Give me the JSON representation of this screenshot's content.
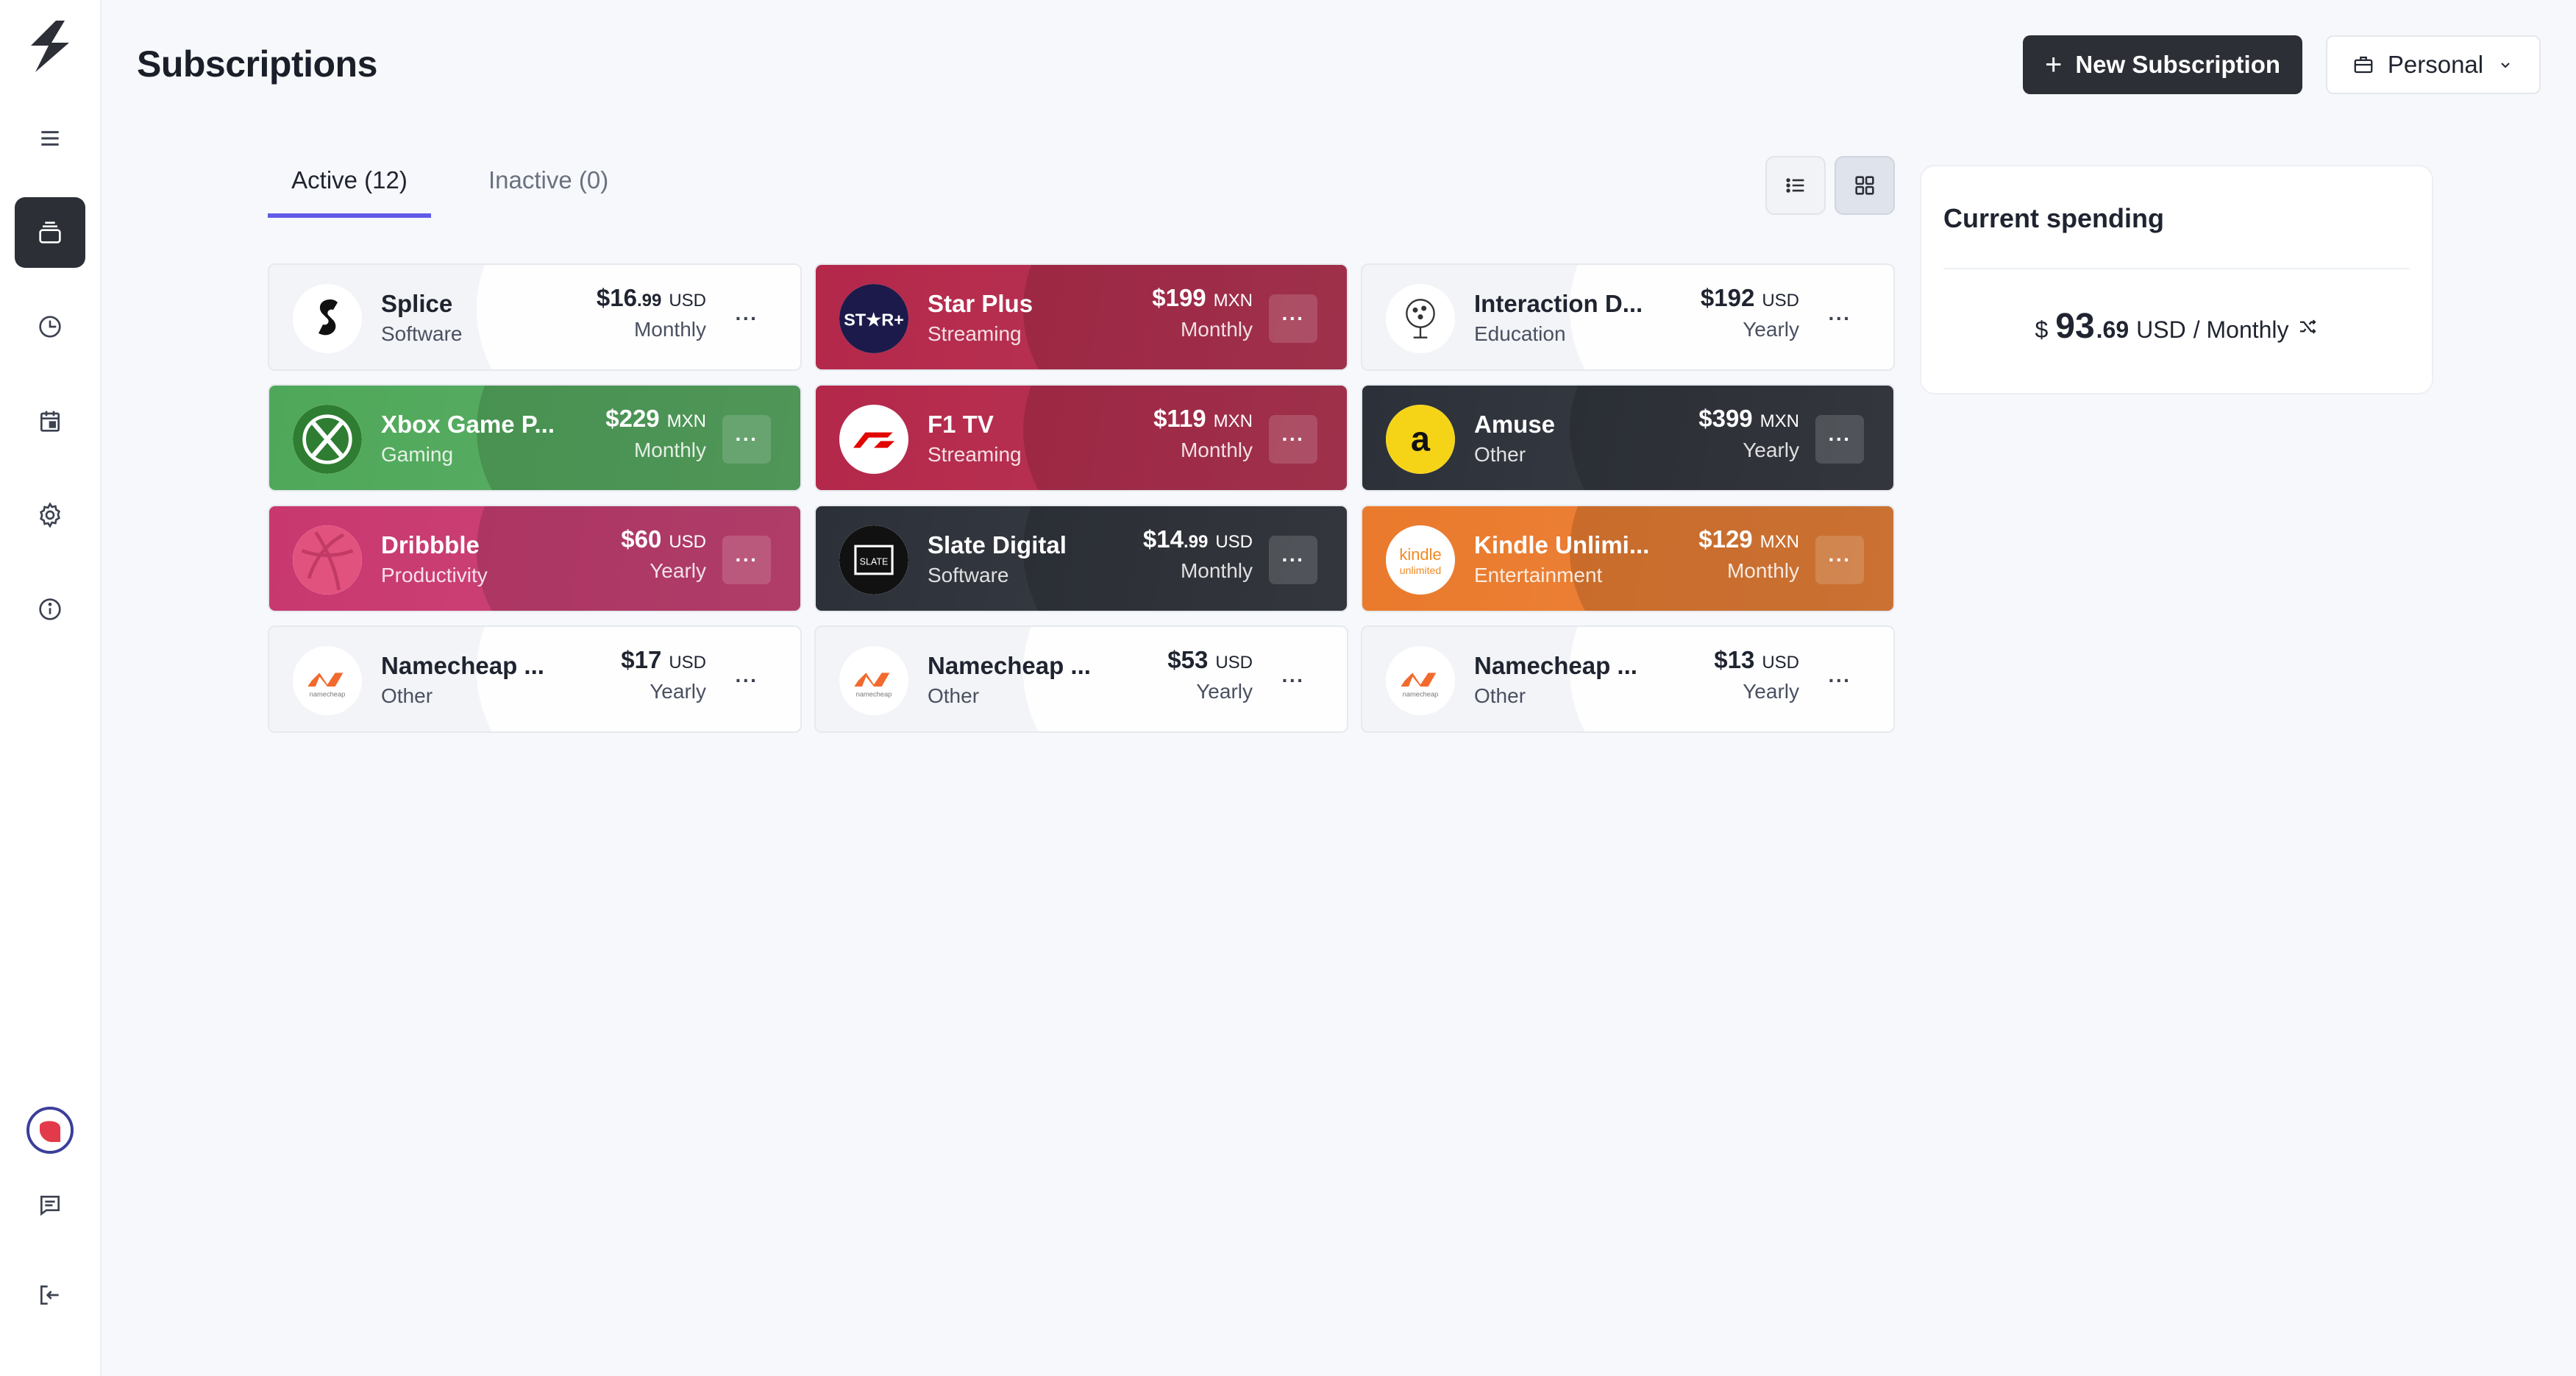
{
  "page": {
    "title": "Subscriptions",
    "new_button_label": "New Subscription",
    "workspace_label": "Personal"
  },
  "tabs": [
    {
      "label": "Active (12)",
      "active": true
    },
    {
      "label": "Inactive (0)",
      "active": false
    }
  ],
  "view_toggle": {
    "selected": "grid",
    "options": [
      "list-icon",
      "grid-icon"
    ]
  },
  "sidebar": {
    "items": [
      {
        "icon": "menu-icon"
      },
      {
        "icon": "subscriptions-icon",
        "active": true
      },
      {
        "icon": "clock-icon"
      },
      {
        "icon": "calendar-icon"
      },
      {
        "icon": "gear-icon"
      },
      {
        "icon": "info-icon"
      }
    ],
    "bottom": [
      {
        "icon": "avatar"
      },
      {
        "icon": "feedback-icon"
      },
      {
        "icon": "logout-icon"
      }
    ]
  },
  "cards": [
    {
      "name": "Splice",
      "category": "Software",
      "price": "$16",
      "cents": ".99",
      "currency": "USD",
      "period": "Monthly",
      "theme": "light",
      "color": "#f3f4f7"
    },
    {
      "name": "Star Plus",
      "category": "Streaming",
      "price": "$199",
      "cents": "",
      "currency": "MXN",
      "period": "Monthly",
      "theme": "dark",
      "color": "#b4284a"
    },
    {
      "name": "Interaction D...",
      "category": "Education",
      "price": "$192",
      "cents": "",
      "currency": "USD",
      "period": "Yearly",
      "theme": "light",
      "color": "#f3f4f7"
    },
    {
      "name": "Xbox Game P...",
      "category": "Gaming",
      "price": "$229",
      "cents": "",
      "currency": "MXN",
      "period": "Monthly",
      "theme": "dark",
      "color": "#4fa85a"
    },
    {
      "name": "F1 TV",
      "category": "Streaming",
      "price": "$119",
      "cents": "",
      "currency": "MXN",
      "period": "Monthly",
      "theme": "dark",
      "color": "#b4284a"
    },
    {
      "name": "Amuse",
      "category": "Other",
      "price": "$399",
      "cents": "",
      "currency": "MXN",
      "period": "Yearly",
      "theme": "dark",
      "color": "#2c3038"
    },
    {
      "name": "Dribbble",
      "category": "Productivity",
      "price": "$60",
      "cents": "",
      "currency": "USD",
      "period": "Yearly",
      "theme": "dark",
      "color": "#c8386f"
    },
    {
      "name": "Slate Digital",
      "category": "Software",
      "price": "$14",
      "cents": ".99",
      "currency": "USD",
      "period": "Monthly",
      "theme": "dark",
      "color": "#2c3038"
    },
    {
      "name": "Kindle Unlimi...",
      "category": "Entertainment",
      "price": "$129",
      "cents": "",
      "currency": "MXN",
      "period": "Monthly",
      "theme": "dark",
      "color": "#ea7a2c"
    },
    {
      "name": "Namecheap ...",
      "category": "Other",
      "price": "$17",
      "cents": "",
      "currency": "USD",
      "period": "Yearly",
      "theme": "light",
      "color": "#f3f4f7"
    },
    {
      "name": "Namecheap ...",
      "category": "Other",
      "price": "$53",
      "cents": "",
      "currency": "USD",
      "period": "Yearly",
      "theme": "light",
      "color": "#f3f4f7"
    },
    {
      "name": "Namecheap ...",
      "category": "Other",
      "price": "$13",
      "cents": "",
      "currency": "USD",
      "period": "Yearly",
      "theme": "light",
      "color": "#f3f4f7"
    }
  ],
  "more_label": "···",
  "spending": {
    "title": "Current spending",
    "symbol": "$",
    "amount": "93",
    "cents": ".69",
    "currency": "USD",
    "period": "/ Monthly"
  }
}
